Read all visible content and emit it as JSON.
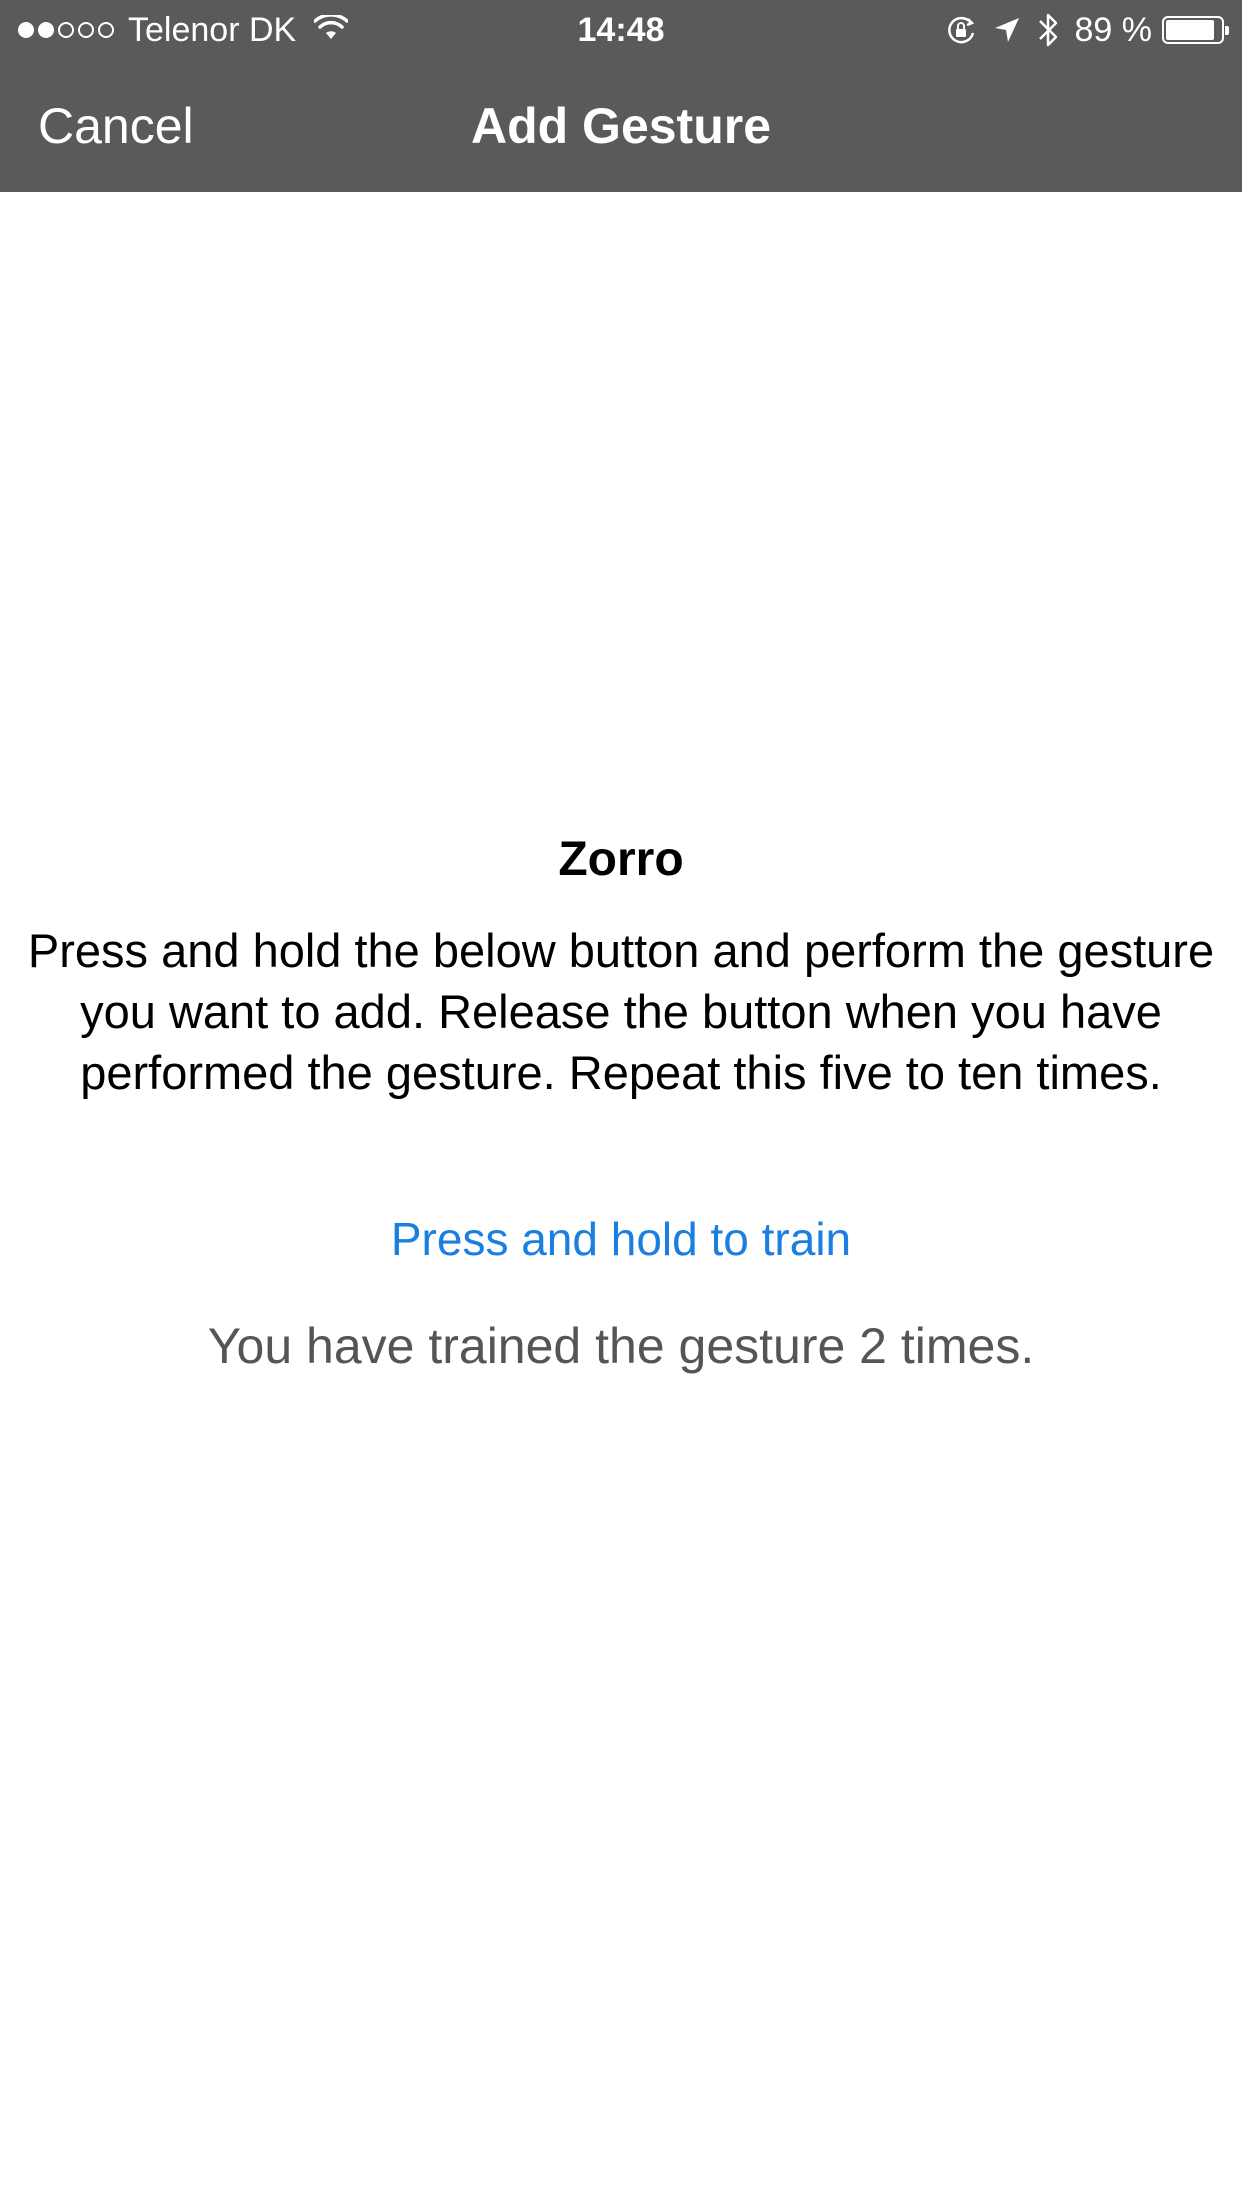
{
  "status_bar": {
    "signal_filled": 2,
    "signal_total": 5,
    "carrier": "Telenor DK",
    "time": "14:48",
    "battery_percent": "89 %",
    "battery_level": 0.89,
    "icons": [
      "wifi-icon",
      "orientation-lock-icon",
      "location-arrow-icon",
      "bluetooth-icon",
      "battery-icon"
    ]
  },
  "nav": {
    "cancel_label": "Cancel",
    "title": "Add Gesture"
  },
  "main": {
    "gesture_name": "Zorro",
    "instructions": "Press and hold the below button and perform the gesture you want to add. Release the button when you have performed the gesture. Repeat this five to ten times.",
    "train_button_label": "Press and hold to train",
    "train_status": "You have trained the gesture 2 times."
  },
  "colors": {
    "bar_background": "#5a5a5a",
    "accent": "#1a7fe0",
    "status_text": "#555555"
  }
}
